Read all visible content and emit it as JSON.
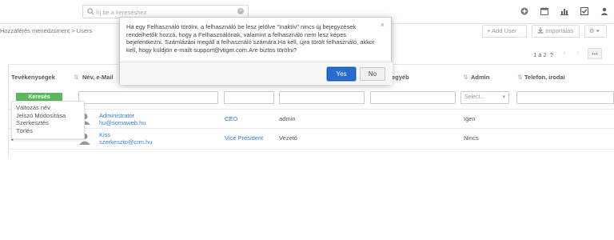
{
  "header": {
    "search_placeholder": "Írj be a kereséshez"
  },
  "breadcrumb": "Hozzáférés menedzsment > Users",
  "toolbar": {
    "add_user": "+ Add User",
    "import": "Importálás",
    "more": "⚙ ▾"
  },
  "pagination": {
    "range": "1 a 2",
    "unknown_total": "?",
    "prev": "‹",
    "next": "›",
    "more": "…"
  },
  "table": {
    "col_actions": "Tevékenységek",
    "col_name": "Név, e-Mail",
    "col_other": "egyéb",
    "col_admin": "Admin",
    "col_phone": "Telefon, irodai",
    "search_button": "Keresés",
    "admin_select_placeholder": "Select...",
    "rows": [
      {
        "name": "Administrator",
        "email": "hu@somaweb.hu",
        "role": "CEO",
        "username": "admin",
        "admin": "Igen"
      },
      {
        "name": "Kiss",
        "email": "szerkeszto@crm.hu",
        "role": "Vice President",
        "username": "Vezető",
        "admin": "Nincs"
      }
    ]
  },
  "row_menu": {
    "items": [
      "Változás név",
      "Jelszó Módosítása",
      "Szerkesztés",
      "Törlés"
    ]
  },
  "modal": {
    "message": "Ha egy Felhasználó törölni, a felhasználó be lesz jelölve \"Inaktív\" nincs új bejegyzések rendelhetők hozzá, hogy a Felhasználónak, valamint a felhasználó nem lesz képes bejelentkezni. Számlázási megáll a felhasználó számára.Ha kell, újra törölt felhasználó, akkor kell, hogy küldjön e-mailt support@vtiger.com.Are biztos törölni?",
    "close": "×",
    "yes": "Yes",
    "no": "No"
  },
  "colors": {
    "primary": "#2a6bcc",
    "success": "#5cb85c",
    "link": "#3b7ddd"
  }
}
